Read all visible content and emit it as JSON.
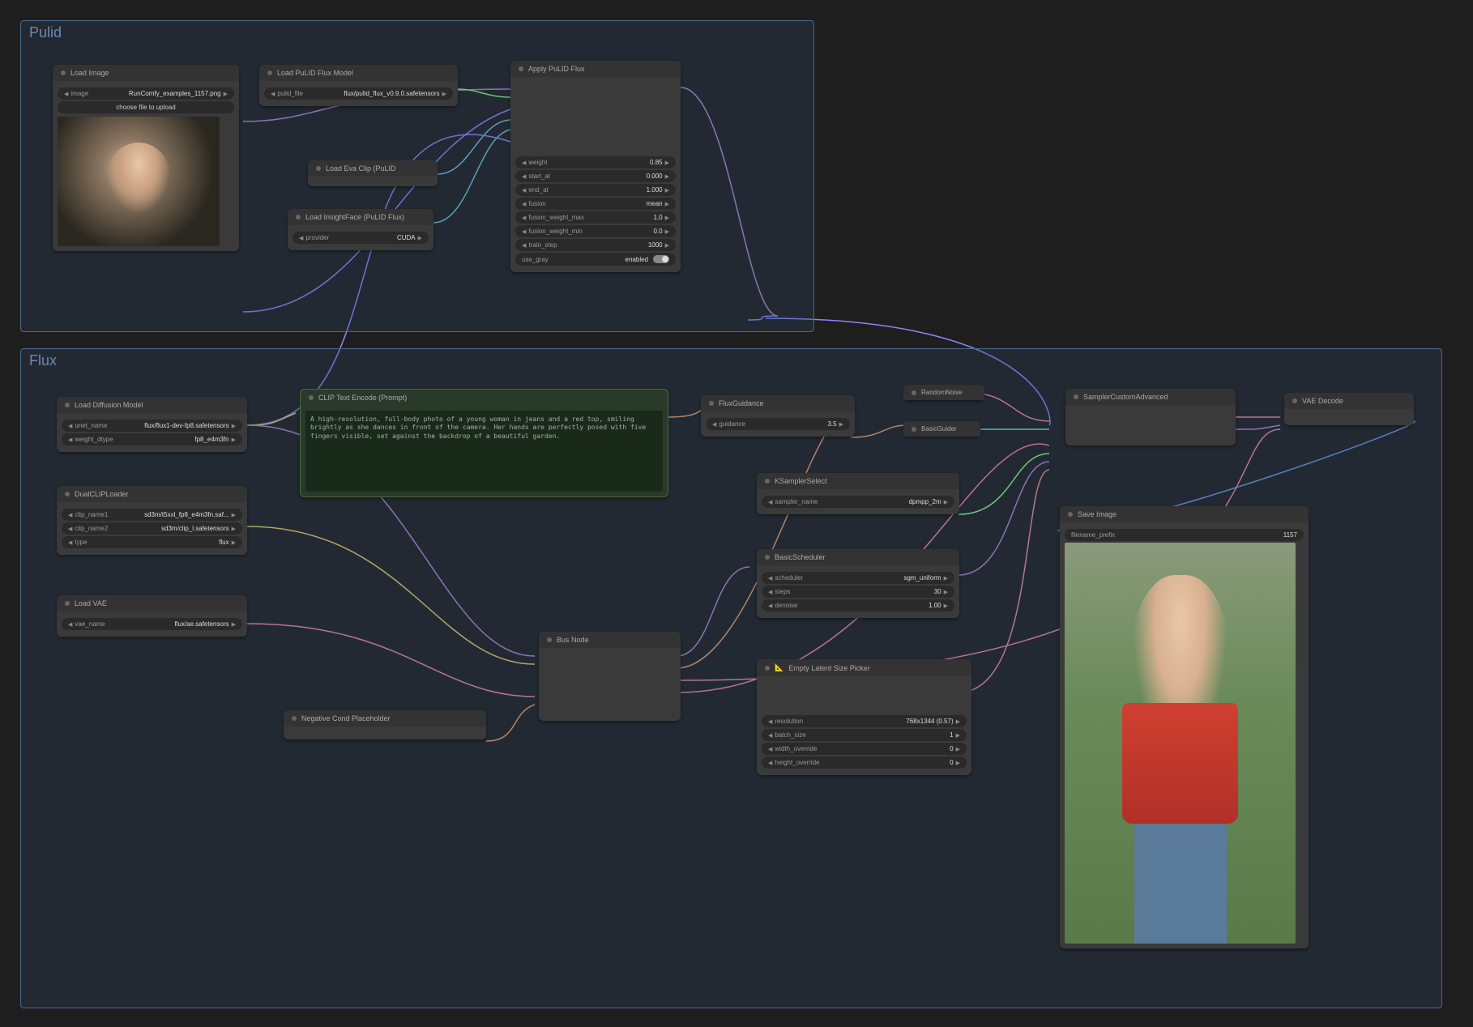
{
  "groups": {
    "pulid": "Pulid",
    "flux": "Flux"
  },
  "nodes": {
    "load_image": {
      "title": "Load Image",
      "image_label": "image",
      "image_value": "RunComfy_examples_1157.png",
      "upload_btn": "choose file to upload"
    },
    "load_pulid_flux": {
      "title": "Load PuLID Flux Model",
      "pulid_file_label": "pulid_file",
      "pulid_file_value": "flux/pulid_flux_v0.9.0.safetensors"
    },
    "load_eva_clip": {
      "title": "Load Eva Clip (PuLID"
    },
    "load_insightface": {
      "title": "Load InsightFace (PuLID Flux)",
      "provider_label": "provider",
      "provider_value": "CUDA"
    },
    "apply_pulid_flux": {
      "title": "Apply PuLID Flux",
      "weight_label": "weight",
      "weight_value": "0.85",
      "start_at_label": "start_at",
      "start_at_value": "0.000",
      "end_at_label": "end_at",
      "end_at_value": "1.000",
      "fusion_label": "fusion",
      "fusion_value": "mean",
      "fusion_weight_max_label": "fusion_weight_max",
      "fusion_weight_max_value": "1.0",
      "fusion_weight_min_label": "fusion_weight_min",
      "fusion_weight_min_value": "0.0",
      "train_step_label": "train_step",
      "train_step_value": "1000",
      "use_gray_label": "use_gray",
      "use_gray_value": "enabled"
    },
    "load_diffusion": {
      "title": "Load Diffusion Model",
      "unet_name_label": "unet_name",
      "unet_name_value": "flux/flux1-dev-fp8.safetensors",
      "weight_dtype_label": "weight_dtype",
      "weight_dtype_value": "fp8_e4m3fn"
    },
    "dual_clip_loader": {
      "title": "DualCLIPLoader",
      "clip_name1_label": "clip_name1",
      "clip_name1_value": "sd3m/t5xxl_fp8_e4m3fn.saf...",
      "clip_name2_label": "clip_name2",
      "clip_name2_value": "sd3m/clip_l.safetensors",
      "type_label": "type",
      "type_value": "flux"
    },
    "load_vae": {
      "title": "Load VAE",
      "vae_name_label": "vae_name",
      "vae_name_value": "flux/ae.safetensors"
    },
    "clip_text_encode": {
      "title": "CLIP Text Encode (Prompt)",
      "prompt": "A high-resolution, full-body photo of a young woman in jeans and a red top, smiling brightly as she dances in front of the camera. Her hands are perfectly posed with five fingers visible, set against the backdrop of a beautiful garden."
    },
    "negative_cond": {
      "title": "Negative Cond Placeholder"
    },
    "bus_node": {
      "title": "Bus Node"
    },
    "flux_guidance": {
      "title": "FluxGuidance",
      "guidance_label": "guidance",
      "guidance_value": "3.5"
    },
    "ksampler_select": {
      "title": "KSamplerSelect",
      "sampler_name_label": "sampler_name",
      "sampler_name_value": "dpmpp_2m"
    },
    "basic_scheduler": {
      "title": "BasicScheduler",
      "scheduler_label": "scheduler",
      "scheduler_value": "sgm_uniform",
      "steps_label": "steps",
      "steps_value": "30",
      "denoise_label": "denoise",
      "denoise_value": "1.00"
    },
    "empty_latent": {
      "title": "Empty Latent Size Picker",
      "resolution_label": "resolution",
      "resolution_value": "768x1344 (0.57)",
      "batch_size_label": "batch_size",
      "batch_size_value": "1",
      "width_override_label": "width_override",
      "width_override_value": "0",
      "height_override_label": "height_override",
      "height_override_value": "0"
    },
    "random_noise": {
      "title": "RandomNoise"
    },
    "basic_guider": {
      "title": "BasicGuider"
    },
    "sampler_custom_adv": {
      "title": "SamplerCustomAdvanced"
    },
    "vae_decode": {
      "title": "VAE Decode"
    },
    "save_image": {
      "title": "Save Image",
      "filename_prefix_label": "filename_prefix",
      "filename_prefix_value": "1157"
    }
  }
}
